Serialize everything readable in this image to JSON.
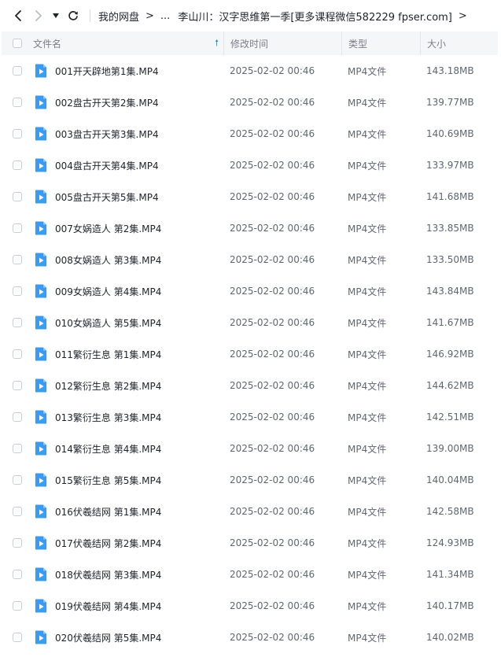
{
  "breadcrumb": {
    "root": "我的网盘",
    "ellipsis": "...",
    "current": "李山川：汉字思维第一季[更多课程微信582229 fpser.com]"
  },
  "header": {
    "name": "文件名",
    "time": "修改时间",
    "type": "类型",
    "size": "大小"
  },
  "colors": {
    "accent": "#1d8cf8",
    "file_icon": "#3a9bf5"
  },
  "files": [
    {
      "name": "001开天辟地第1集.MP4",
      "time": "2025-02-02 00:46",
      "type": "MP4文件",
      "size": "143.18MB"
    },
    {
      "name": "002盘古开天第2集.MP4",
      "time": "2025-02-02 00:46",
      "type": "MP4文件",
      "size": "139.77MB"
    },
    {
      "name": "003盘古开天第3集.MP4",
      "time": "2025-02-02 00:46",
      "type": "MP4文件",
      "size": "140.69MB"
    },
    {
      "name": "004盘古开天第4集.MP4",
      "time": "2025-02-02 00:46",
      "type": "MP4文件",
      "size": "133.97MB"
    },
    {
      "name": "005盘古开天第5集.MP4",
      "time": "2025-02-02 00:46",
      "type": "MP4文件",
      "size": "141.68MB"
    },
    {
      "name": "007女娲造人 第2集.MP4",
      "time": "2025-02-02 00:46",
      "type": "MP4文件",
      "size": "133.85MB"
    },
    {
      "name": "008女娲造人 第3集.MP4",
      "time": "2025-02-02 00:46",
      "type": "MP4文件",
      "size": "133.50MB"
    },
    {
      "name": "009女娲造人 第4集.MP4",
      "time": "2025-02-02 00:46",
      "type": "MP4文件",
      "size": "143.84MB"
    },
    {
      "name": "010女娲造人 第5集.MP4",
      "time": "2025-02-02 00:46",
      "type": "MP4文件",
      "size": "141.67MB"
    },
    {
      "name": "011繁衍生息 第1集.MP4",
      "time": "2025-02-02 00:46",
      "type": "MP4文件",
      "size": "146.92MB"
    },
    {
      "name": "012繁衍生息 第2集.MP4",
      "time": "2025-02-02 00:46",
      "type": "MP4文件",
      "size": "144.62MB"
    },
    {
      "name": "013繁衍生息 第3集.MP4",
      "time": "2025-02-02 00:46",
      "type": "MP4文件",
      "size": "142.51MB"
    },
    {
      "name": "014繁衍生息 第4集.MP4",
      "time": "2025-02-02 00:46",
      "type": "MP4文件",
      "size": "139.00MB"
    },
    {
      "name": "015繁衍生息 第5集.MP4",
      "time": "2025-02-02 00:46",
      "type": "MP4文件",
      "size": "140.04MB"
    },
    {
      "name": "016伏羲结网 第1集.MP4",
      "time": "2025-02-02 00:46",
      "type": "MP4文件",
      "size": "142.58MB"
    },
    {
      "name": "017伏羲结网 第2集.MP4",
      "time": "2025-02-02 00:46",
      "type": "MP4文件",
      "size": "124.93MB"
    },
    {
      "name": "018伏羲结网 第3集.MP4",
      "time": "2025-02-02 00:46",
      "type": "MP4文件",
      "size": "141.34MB"
    },
    {
      "name": "019伏羲结网 第4集.MP4",
      "time": "2025-02-02 00:46",
      "type": "MP4文件",
      "size": "140.17MB"
    },
    {
      "name": "020伏羲结网 第5集.MP4",
      "time": "2025-02-02 00:46",
      "type": "MP4文件",
      "size": "140.02MB"
    }
  ]
}
